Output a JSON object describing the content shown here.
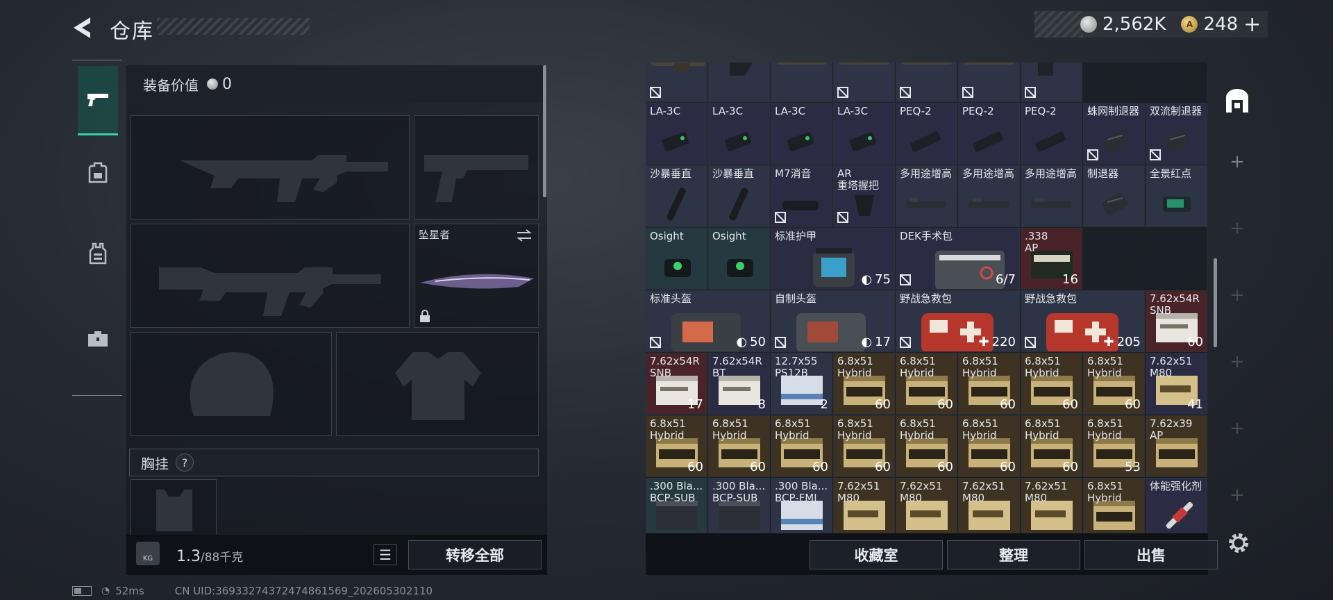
{
  "header": {
    "title": "仓库",
    "back_icon": "back-arrow-icon"
  },
  "currency": {
    "silver_value": "2,562K",
    "gold_value": "248",
    "plus_label": "+",
    "silver_icon": "silver-coin-icon",
    "gold_icon": "gold-coin-icon"
  },
  "tabs": [
    {
      "icon": "pistol-icon",
      "active": true
    },
    {
      "icon": "backpack-icon",
      "active": false
    },
    {
      "icon": "vest-icon",
      "active": false
    },
    {
      "icon": "toolbox-icon",
      "active": false
    }
  ],
  "equipment": {
    "value_label": "装备价值",
    "value": "0",
    "melee_name": "坠星者",
    "chest_label": "胸挂",
    "help_label": "?",
    "weight_value": "1.3",
    "weight_max": "/88千克",
    "kg_icon_label": "KG",
    "transfer_all": "转移全部"
  },
  "stash": {
    "rows": [
      [
        {
          "name": "",
          "count": "",
          "bg": "#2c3446",
          "art": "scope",
          "nocross": true
        },
        {
          "name": "",
          "count": "",
          "bg": "#2c3446",
          "art": "stock",
          "nocross": false
        },
        {
          "name": "",
          "count": "",
          "bg": "#2c3446",
          "art": "rail",
          "nocross": false
        },
        {
          "name": "",
          "count": "",
          "bg": "#2c3446",
          "art": "rail",
          "nocross": true
        },
        {
          "name": "",
          "count": "",
          "bg": "#2c3446",
          "art": "rail",
          "nocross": true
        },
        {
          "name": "",
          "count": "",
          "bg": "#2c3446",
          "art": "rail",
          "nocross": true
        },
        {
          "name": "",
          "count": "",
          "bg": "#2c3446",
          "art": "mag",
          "nocross": true
        }
      ],
      [
        {
          "name": "LA-3C",
          "count": "",
          "bg": "#2b2c43",
          "art": "laser",
          "nocross": false
        },
        {
          "name": "LA-3C",
          "count": "",
          "bg": "#2b2c43",
          "art": "laser",
          "nocross": false
        },
        {
          "name": "LA-3C",
          "count": "",
          "bg": "#2b2c43",
          "art": "laser",
          "nocross": false
        },
        {
          "name": "LA-3C",
          "count": "",
          "bg": "#2b2c43",
          "art": "laser",
          "nocross": false
        },
        {
          "name": "PEQ-2",
          "count": "",
          "bg": "#2b2c43",
          "art": "peq",
          "nocross": false
        },
        {
          "name": "PEQ-2",
          "count": "",
          "bg": "#2b2c43",
          "art": "peq",
          "nocross": false
        },
        {
          "name": "PEQ-2",
          "count": "",
          "bg": "#2b2c43",
          "art": "peq",
          "nocross": false
        },
        {
          "name": "蛛网制退器",
          "count": "",
          "bg": "#2b2c43",
          "art": "brake",
          "nocross": true
        },
        {
          "name": "双流制退器",
          "count": "",
          "bg": "#2b2c43",
          "art": "brake",
          "nocross": true
        }
      ],
      [
        {
          "name": "沙暴垂直",
          "count": "",
          "bg": "#2c3446",
          "art": "grip",
          "nocross": false
        },
        {
          "name": "沙暴垂直",
          "count": "",
          "bg": "#2c3446",
          "art": "grip",
          "nocross": false
        },
        {
          "name": "M7消音",
          "count": "",
          "bg": "#2b2c43",
          "art": "silencer",
          "nocross": true
        },
        {
          "name": "AR\n重塔握把",
          "count": "",
          "bg": "#2b2c43",
          "art": "pgrip",
          "nocross": true
        },
        {
          "name": "多用途增高",
          "count": "",
          "bg": "#2c3446",
          "art": "riser",
          "nocross": false
        },
        {
          "name": "多用途增高",
          "count": "",
          "bg": "#2c3446",
          "art": "riser",
          "nocross": false
        },
        {
          "name": "多用途增高",
          "count": "",
          "bg": "#2c3446",
          "art": "riser",
          "nocross": false
        },
        {
          "name": "制退器",
          "count": "",
          "bg": "#2c3446",
          "art": "brake",
          "nocross": false
        },
        {
          "name": "全景红点",
          "count": "",
          "bg": "#2c3446",
          "art": "holo",
          "nocross": false
        }
      ],
      [
        {
          "name": "Osight",
          "count": "",
          "bg": "#243a40",
          "art": "osight",
          "nocross": false
        },
        {
          "name": "Osight",
          "count": "",
          "bg": "#243a40",
          "art": "osight",
          "nocross": false
        },
        {
          "name": "标准护甲",
          "count": "75",
          "bg": "#2b2c43",
          "art": "armor",
          "nocross": false,
          "wide": true,
          "shield": true
        },
        {
          "name": "DEK手术包",
          "count": "6/7",
          "bg": "#2b2c43",
          "art": "surgery",
          "nocross": true,
          "wide": true
        },
        {
          "name": ".338\nAP",
          "count": "16",
          "bg": "#4a2328",
          "art": "ammo338",
          "nocross": false
        }
      ],
      [
        {
          "name": "标准头盔",
          "count": "50",
          "bg": "#2c3446",
          "art": "helmetbag",
          "nocross": true,
          "wide": true,
          "shield": true
        },
        {
          "name": "自制头盔",
          "count": "17",
          "bg": "#2c3446",
          "art": "helmetbag2",
          "nocross": true,
          "wide": true,
          "shield": true
        },
        {
          "name": "野战急救包",
          "count": "220",
          "bg": "#2c3446",
          "art": "medkit",
          "nocross": true,
          "wide": true,
          "heal": true
        },
        {
          "name": "野战急救包",
          "count": "205",
          "bg": "#2c3446",
          "art": "medkit",
          "nocross": true,
          "wide": true,
          "heal": true
        },
        {
          "name": "7.62x54R\nSNB",
          "count": "60",
          "bg": "#4a2328",
          "art": "ammowhite",
          "nocross": false
        }
      ],
      [
        {
          "name": "7.62x54R\nSNB",
          "count": "17",
          "bg": "#4a2328",
          "art": "ammowhite",
          "nocross": false
        },
        {
          "name": "7.62x54R\nBT",
          "count": "8",
          "bg": "#2b2c43",
          "art": "ammowhite",
          "nocross": false
        },
        {
          "name": "12.7x55\nPS12B",
          "count": "2",
          "bg": "#2c3446",
          "art": "ammoblue",
          "nocross": false
        },
        {
          "name": "6.8x51\nHybrid",
          "count": "60",
          "bg": "#3e3323",
          "art": "ammogold",
          "nocross": false
        },
        {
          "name": "6.8x51\nHybrid",
          "count": "60",
          "bg": "#3e3323",
          "art": "ammogold",
          "nocross": false
        },
        {
          "name": "6.8x51\nHybrid",
          "count": "60",
          "bg": "#3e3323",
          "art": "ammogold",
          "nocross": false
        },
        {
          "name": "6.8x51\nHybrid",
          "count": "60",
          "bg": "#3e3323",
          "art": "ammogold",
          "nocross": false
        },
        {
          "name": "6.8x51\nHybrid",
          "count": "60",
          "bg": "#3e3323",
          "art": "ammogold",
          "nocross": false
        },
        {
          "name": "7.62x51\nM80",
          "count": "41",
          "bg": "#2b2c43",
          "art": "ammotan",
          "nocross": false
        }
      ],
      [
        {
          "name": "6.8x51\nHybrid",
          "count": "60",
          "bg": "#3e3323",
          "art": "ammogold",
          "nocross": false
        },
        {
          "name": "6.8x51\nHybrid",
          "count": "60",
          "bg": "#3e3323",
          "art": "ammogold",
          "nocross": false
        },
        {
          "name": "6.8x51\nHybrid",
          "count": "60",
          "bg": "#3e3323",
          "art": "ammogold",
          "nocross": false
        },
        {
          "name": "6.8x51\nHybrid",
          "count": "60",
          "bg": "#3e3323",
          "art": "ammogold",
          "nocross": false
        },
        {
          "name": "6.8x51\nHybrid",
          "count": "60",
          "bg": "#3e3323",
          "art": "ammogold",
          "nocross": false
        },
        {
          "name": "6.8x51\nHybrid",
          "count": "60",
          "bg": "#3e3323",
          "art": "ammogold",
          "nocross": false
        },
        {
          "name": "6.8x51\nHybrid",
          "count": "60",
          "bg": "#3e3323",
          "art": "ammogold",
          "nocross": false
        },
        {
          "name": "6.8x51\nHybrid",
          "count": "53",
          "bg": "#3e3323",
          "art": "ammogold",
          "nocross": false
        },
        {
          "name": "7.62x39\nAP",
          "count": "",
          "bg": "#3e3323",
          "art": "ammogold",
          "nocross": false
        }
      ],
      [
        {
          "name": ".300 Bla...\nBCP-SUB",
          "count": "",
          "bg": "#243a40",
          "art": "ammodark",
          "nocross": false
        },
        {
          "name": ".300 Bla...\nBCP-SUB",
          "count": "",
          "bg": "#2c3446",
          "art": "ammodark",
          "nocross": false
        },
        {
          "name": ".300 Bla...\nBCP-FMJ",
          "count": "",
          "bg": "#2c3446",
          "art": "ammoblue",
          "nocross": false
        },
        {
          "name": "7.62x51\nM80",
          "count": "",
          "bg": "#3e3323",
          "art": "ammotan",
          "nocross": false
        },
        {
          "name": "7.62x51\nM80",
          "count": "",
          "bg": "#3e3323",
          "art": "ammotan",
          "nocross": false
        },
        {
          "name": "7.62x51\nM80",
          "count": "",
          "bg": "#3e3323",
          "art": "ammotan",
          "nocross": false
        },
        {
          "name": "7.62x51\nM80",
          "count": "",
          "bg": "#3e3323",
          "art": "ammotan",
          "nocross": false
        },
        {
          "name": "6.8x51\nHybrid",
          "count": "",
          "bg": "#3e3323",
          "art": "ammogold",
          "nocross": false
        },
        {
          "name": "体能强化剂",
          "count": "",
          "bg": "#2b2c43",
          "art": "syringe",
          "nocross": false
        }
      ]
    ]
  },
  "buttons": {
    "favorites": "收藏室",
    "sort": "整理",
    "sell": "出售"
  },
  "right_sidebar": {
    "stash_icon": "stash-icon",
    "add_icons": [
      "+",
      "+",
      "+",
      "+",
      "+",
      "+",
      "+"
    ],
    "settings_icon": "gear-icon"
  },
  "status_bar": {
    "ping": "52ms",
    "uid": "CN UID:3693327437247486156​9_202605302110"
  }
}
